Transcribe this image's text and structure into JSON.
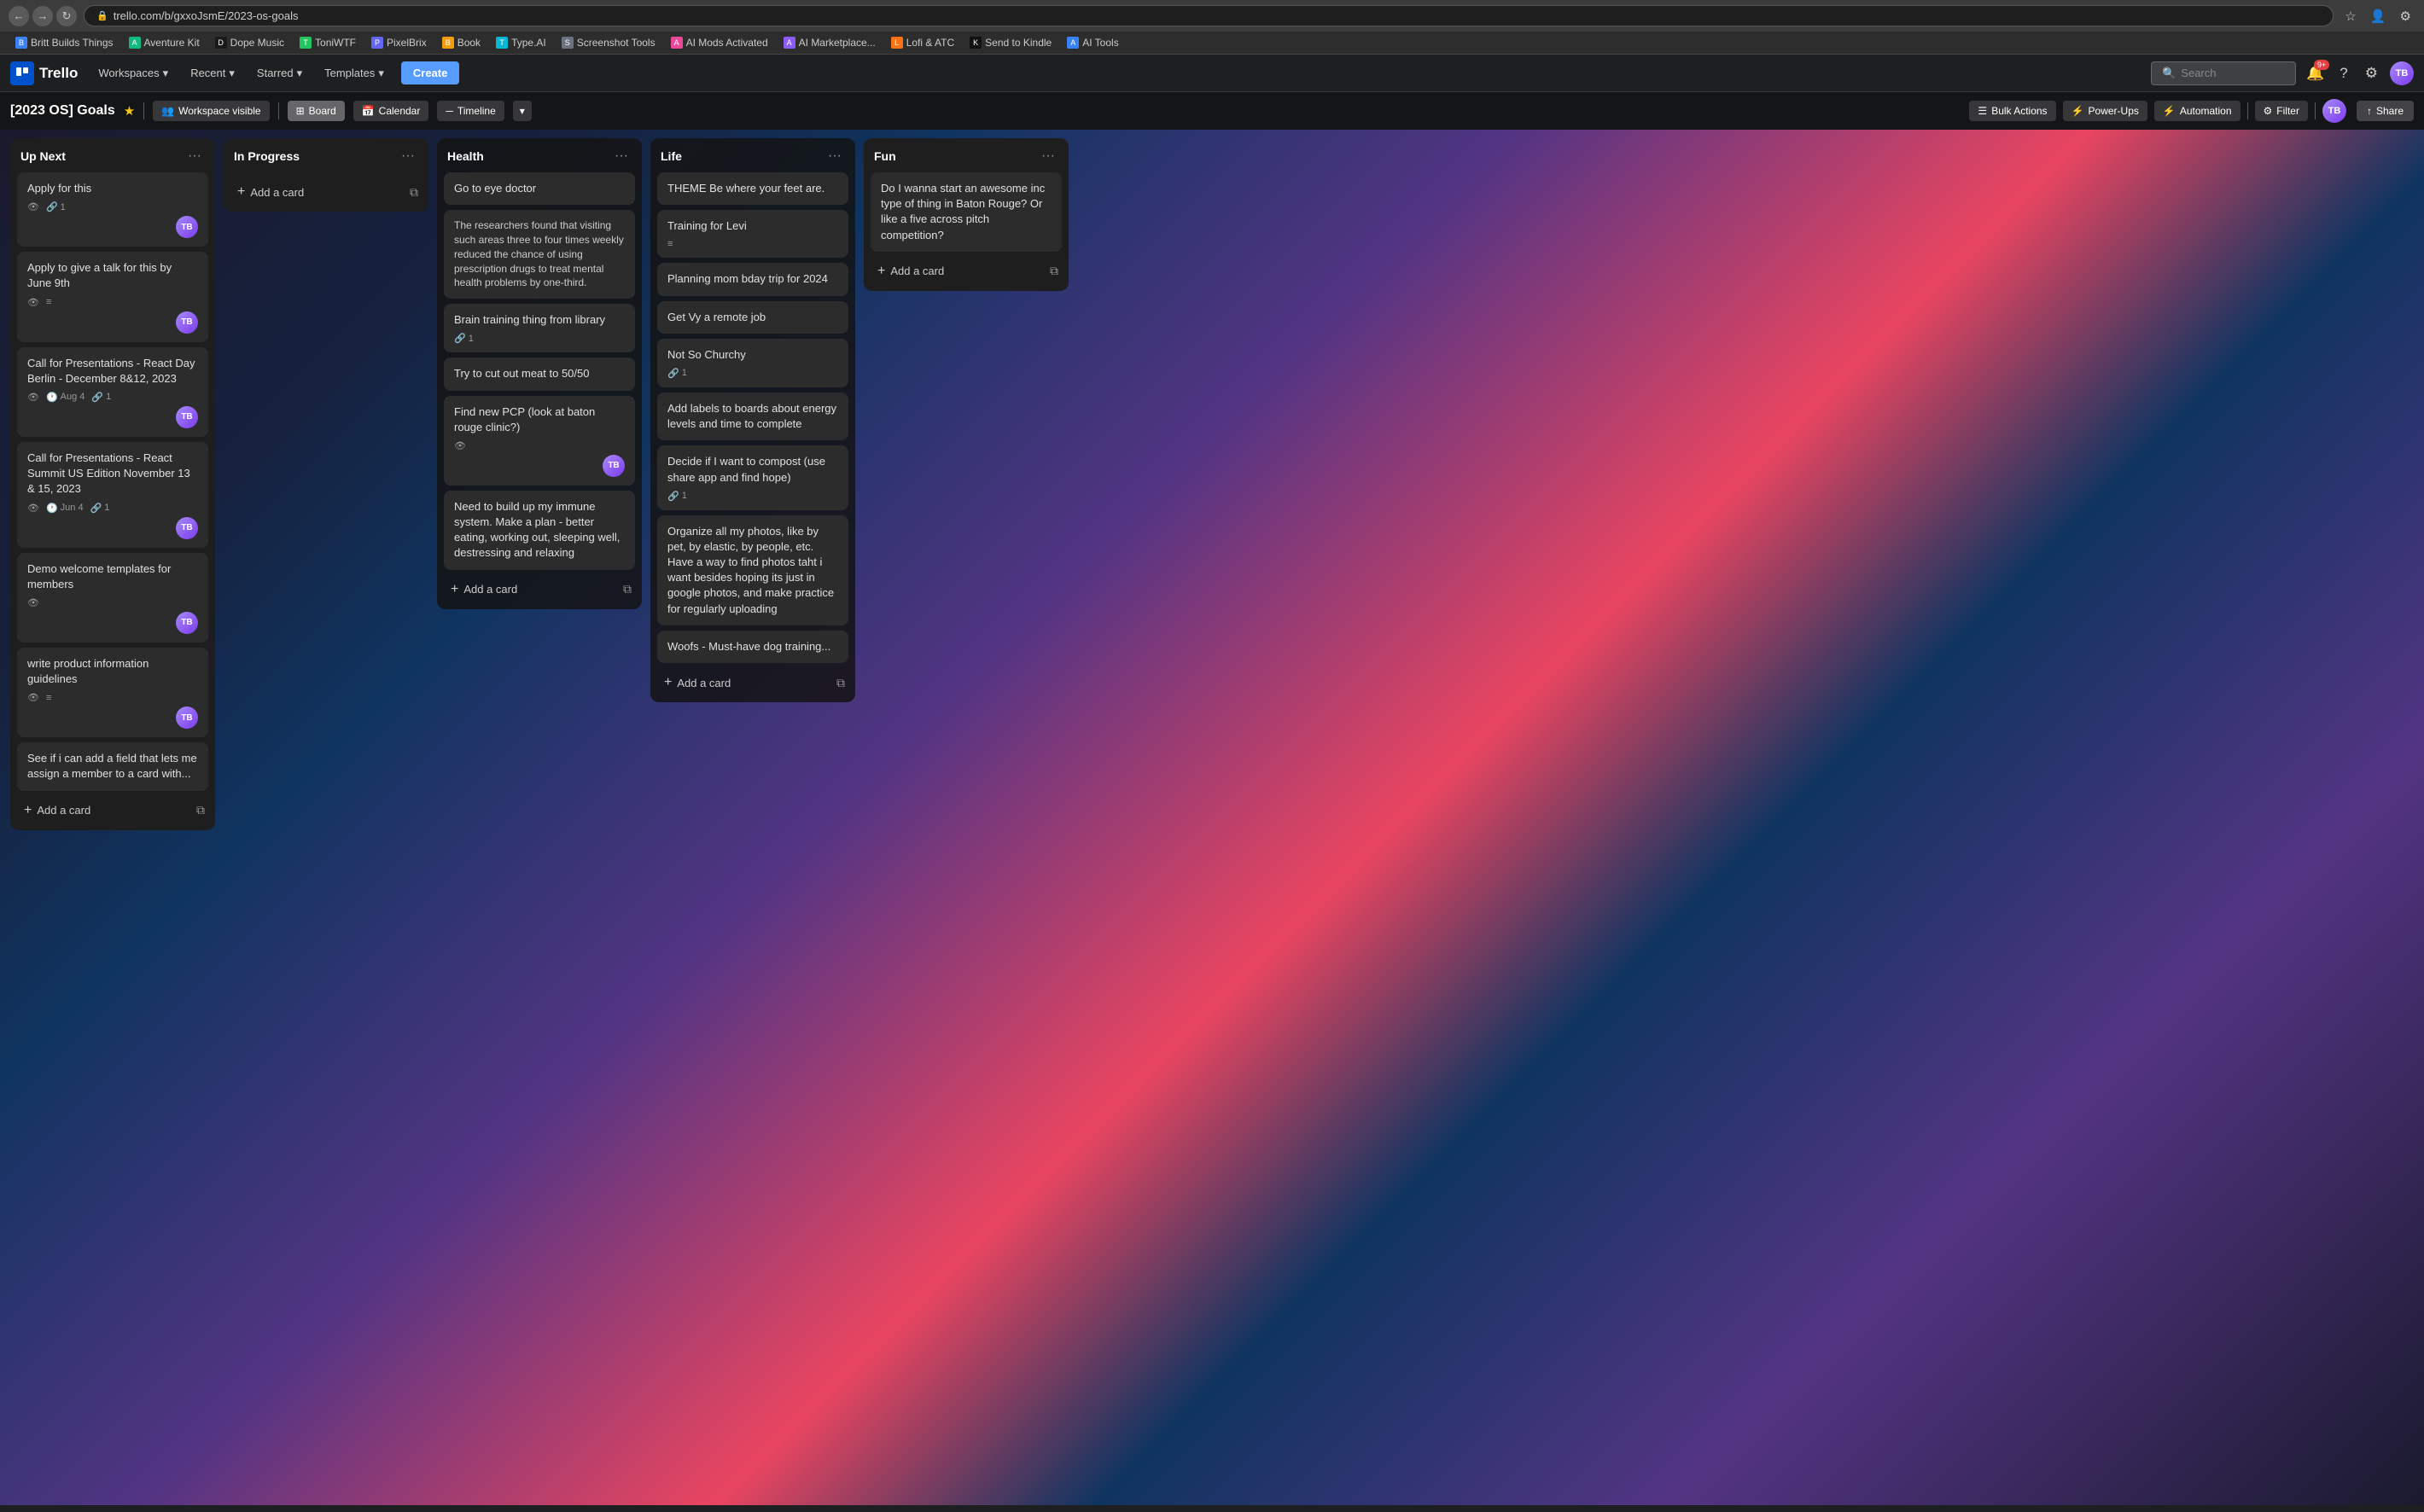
{
  "browser": {
    "url": "trello.com/b/gxxoJsmE/2023-os-goals",
    "back_btn": "←",
    "forward_btn": "→",
    "refresh_btn": "↻",
    "bookmarks": [
      {
        "label": "Britt Builds Things",
        "favicon": "B",
        "color": "#3b82f6"
      },
      {
        "label": "Aventure Kit",
        "favicon": "A",
        "color": "#10b981"
      },
      {
        "label": "Dope Music",
        "favicon": "D",
        "color": "#1a1a1a"
      },
      {
        "label": "ToniWTF",
        "favicon": "T",
        "color": "#22c55e"
      },
      {
        "label": "PixelBrix",
        "favicon": "P",
        "color": "#6366f1"
      },
      {
        "label": "Book",
        "favicon": "B",
        "color": "#f59e0b"
      },
      {
        "label": "Type.AI",
        "favicon": "T",
        "color": "#06b6d4"
      },
      {
        "label": "Screenshot Tools",
        "favicon": "S",
        "color": "#6b7280"
      },
      {
        "label": "AI Mods Activated",
        "favicon": "A",
        "color": "#ec4899"
      },
      {
        "label": "AI Marketplace...",
        "favicon": "A",
        "color": "#8b5cf6"
      },
      {
        "label": "Lofi & ATC",
        "favicon": "L",
        "color": "#f97316"
      },
      {
        "label": "Send to Kindle",
        "favicon": "K",
        "color": "#111"
      },
      {
        "label": "AI Tools",
        "favicon": "A",
        "color": "#3b82f6"
      }
    ]
  },
  "trello": {
    "logo": "Trello",
    "nav": {
      "workspaces": "Workspaces",
      "recent": "Recent",
      "starred": "Starred",
      "templates": "Templates",
      "create": "Create"
    },
    "search_placeholder": "Search",
    "notification_count": "9+",
    "board": {
      "title": "[2023 OS] Goals",
      "visibility": "Workspace visible",
      "views": [
        {
          "label": "Board",
          "active": true,
          "icon": "⊞"
        },
        {
          "label": "Calendar",
          "active": false,
          "icon": "📅"
        },
        {
          "label": "Timeline",
          "active": false,
          "icon": "📊"
        }
      ],
      "actions": {
        "bulk_actions": "Bulk Actions",
        "power_ups": "Power-Ups",
        "automation": "Automation",
        "filter": "Filter",
        "share": "Share"
      }
    },
    "lists": [
      {
        "id": "up-next",
        "title": "Up Next",
        "cards": [
          {
            "id": "c1",
            "title": "Apply for this",
            "meta": {
              "eye": true,
              "attachment": true,
              "count": 1
            },
            "avatar": {
              "initials": "TB",
              "color": "purple"
            }
          },
          {
            "id": "c2",
            "title": "Apply to give a talk for this by June 9th",
            "meta": {
              "eye": true,
              "lines": true
            },
            "avatar": {
              "initials": "TB",
              "color": "purple"
            }
          },
          {
            "id": "c3",
            "title": "Call for Presentations - React Day Berlin - December 8&12, 2023",
            "meta": {
              "eye": true,
              "clock": "Aug 4",
              "attachment": true,
              "count": 1
            },
            "avatar": {
              "initials": "TB",
              "color": "purple"
            }
          },
          {
            "id": "c4",
            "title": "Call for Presentations - React Summit US Edition November 13 & 15, 2023",
            "meta": {
              "eye": true,
              "clock": "Jun 4",
              "attachment": true,
              "count": 1
            },
            "avatar": {
              "initials": "TB",
              "color": "purple"
            }
          },
          {
            "id": "c5",
            "title": "Demo welcome templates for members",
            "meta": {
              "eye": true
            },
            "avatar": {
              "initials": "TB",
              "color": "purple"
            }
          },
          {
            "id": "c6",
            "title": "write product information guidelines",
            "meta": {
              "eye": true,
              "lines": true
            },
            "avatar": {
              "initials": "TB",
              "color": "purple"
            }
          },
          {
            "id": "c7",
            "title": "See if i can add a field that lets me assign a member to a card with...",
            "meta": {},
            "avatar": null
          }
        ],
        "add_card": "Add a card"
      },
      {
        "id": "in-progress",
        "title": "In Progress",
        "cards": [],
        "add_card": "Add a card"
      },
      {
        "id": "health",
        "title": "Health",
        "cards": [
          {
            "id": "h1",
            "title": "Go to eye doctor",
            "meta": {},
            "avatar": null
          },
          {
            "id": "h2",
            "title": "The researchers found that visiting such areas three to four times weekly reduced the chance of using prescription drugs to treat mental health problems by one-third.",
            "meta": {},
            "avatar": null,
            "description": true
          },
          {
            "id": "h3",
            "title": "Brain training thing from library",
            "meta": {
              "attachment": true,
              "count": 1
            },
            "avatar": null
          },
          {
            "id": "h4",
            "title": "Try to cut out meat to 50/50",
            "meta": {},
            "avatar": null
          },
          {
            "id": "h5",
            "title": "Find new PCP (look at baton rouge clinic?)",
            "meta": {
              "eye": true
            },
            "avatar": {
              "initials": "TB",
              "color": "purple"
            }
          },
          {
            "id": "h6",
            "title": "Need to build up my immune system. Make a plan - better eating, working out, sleeping well, destressing and relaxing",
            "meta": {},
            "avatar": null
          }
        ],
        "add_card": "Add a card"
      },
      {
        "id": "life",
        "title": "Life",
        "cards": [
          {
            "id": "l1",
            "title": "THEME Be where your feet are.",
            "meta": {},
            "avatar": null
          },
          {
            "id": "l2",
            "title": "Training for Levi",
            "meta": {
              "lines": true
            },
            "avatar": null
          },
          {
            "id": "l3",
            "title": "Planning mom bday trip for 2024",
            "meta": {},
            "avatar": null
          },
          {
            "id": "l4",
            "title": "Get Vy a remote job",
            "meta": {},
            "avatar": null
          },
          {
            "id": "l5",
            "title": "Not So Churchy",
            "meta": {
              "attachment": true,
              "count": 1
            },
            "avatar": null
          },
          {
            "id": "l6",
            "title": "Add labels to boards about energy levels and time to complete",
            "meta": {},
            "avatar": null
          },
          {
            "id": "l7",
            "title": "Decide if I want to compost (use share app and find hope)",
            "meta": {
              "attachment": true,
              "count": 1
            },
            "avatar": null
          },
          {
            "id": "l8",
            "title": "Organize all my photos, like by pet, by elastic, by people, etc. Have a way to find photos taht i want besides hoping its just in google photos, and make practice for regularly uploading",
            "meta": {},
            "avatar": null
          },
          {
            "id": "l9",
            "title": "Woofs - Must-have dog training...",
            "meta": {},
            "avatar": null
          }
        ],
        "add_card": "Add a card"
      },
      {
        "id": "fun",
        "title": "Fun",
        "cards": [
          {
            "id": "f1",
            "title": "Do I wanna start an awesome inc type of thing in Baton Rouge? Or like a five across pitch competition?",
            "meta": {},
            "avatar": null
          }
        ],
        "add_card": "Add a card"
      }
    ]
  },
  "icons": {
    "eye": "👁",
    "attachment": "🔗",
    "clock": "🕐",
    "lines": "≡",
    "add": "+",
    "copy": "⧉",
    "star": "★",
    "chevron": "▾",
    "lock": "🔒",
    "bell": "🔔",
    "question": "?",
    "grid": "⊞",
    "calendar": "📅",
    "timeline": "—",
    "lightning": "⚡",
    "filter": "⚙",
    "people": "👥",
    "menu": "···",
    "search": "🔍",
    "profile": "👤",
    "board": "⊞",
    "share": "↑",
    "power": "⚡",
    "automation": "⚡",
    "bulk": "☰",
    "more": "•••"
  }
}
